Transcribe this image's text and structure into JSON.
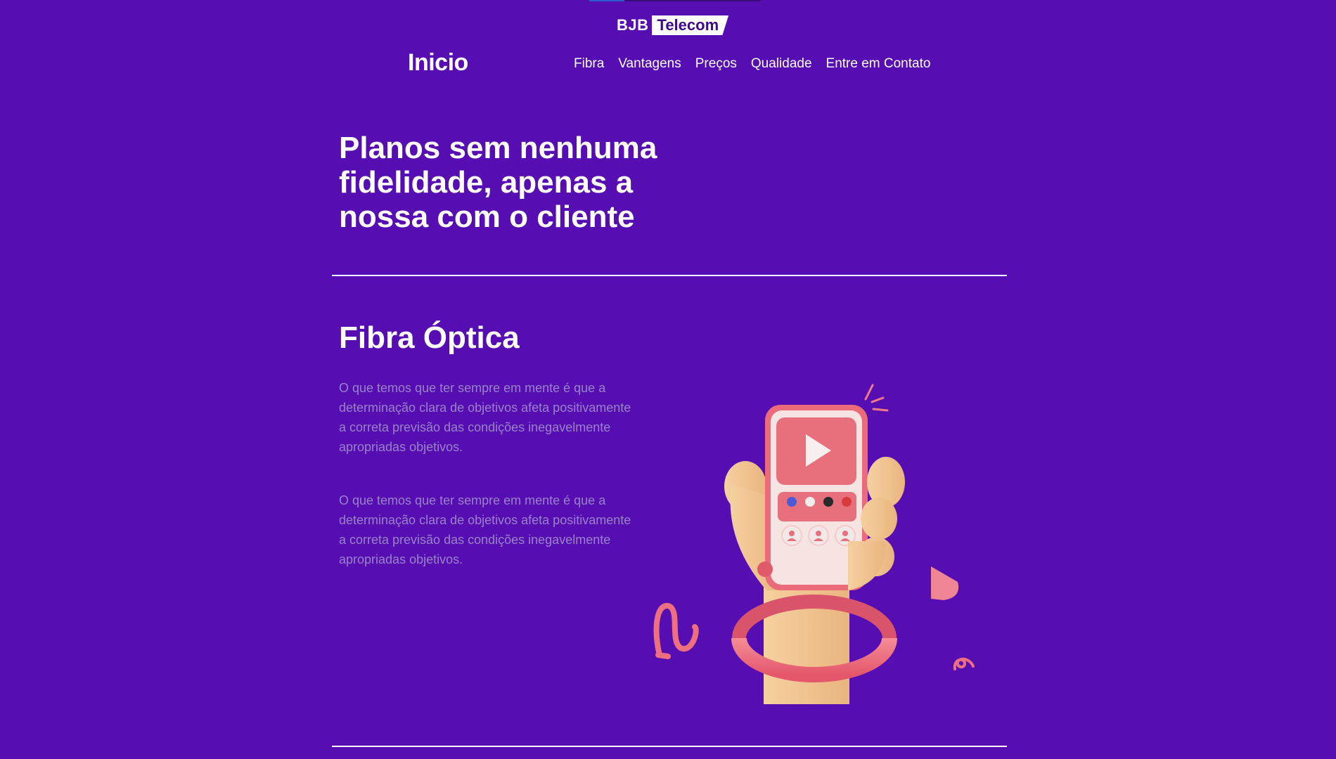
{
  "header": {
    "logo_left": "BJB",
    "logo_right": "Telecom"
  },
  "nav": {
    "home": "Inicio",
    "links": [
      "Fibra",
      "Vantagens",
      "Preços",
      "Qualidade",
      "Entre em Contato"
    ]
  },
  "hero": {
    "title": "Planos sem nenhuma fidelidade, apenas a nossa com o cliente"
  },
  "fibra": {
    "title": "Fibra Óptica",
    "paragraphs": [
      "O que temos que ter sempre em mente é que a determinação clara de objetivos afeta positivamente a correta previsão das condições inegavelmente apropriadas objetivos.",
      "O que temos que ter sempre em mente é que a determinação clara de objetivos afeta positivamente a correta previsão das condições inegavelmente apropriadas objetivos."
    ],
    "illustration_icon": "hand-holding-phone-play-icon"
  },
  "colors": {
    "background": "#560db2",
    "text": "#ffffff",
    "muted_text": "#9a82c9",
    "accent_pink": "#ec6b7a",
    "skin": "#f3c690"
  }
}
